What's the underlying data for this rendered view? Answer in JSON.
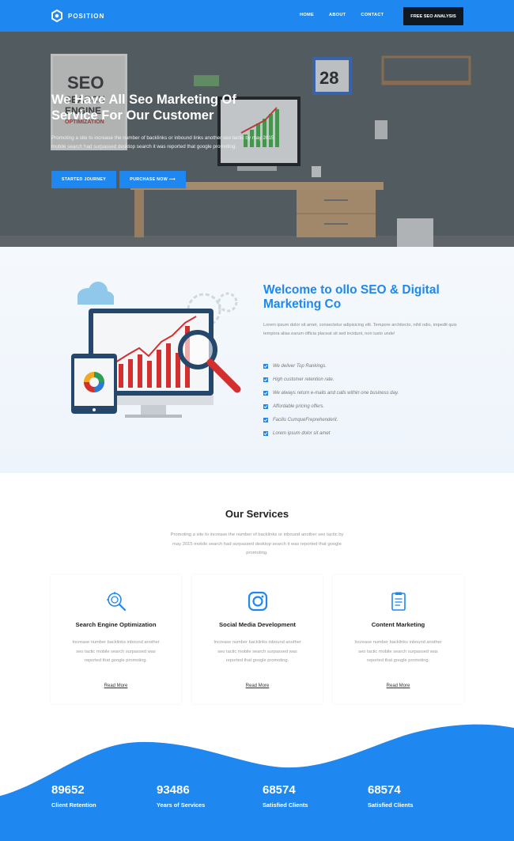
{
  "nav": {
    "brand": "POSITION",
    "links": [
      "HOME",
      "ABOUT",
      "CONTACT"
    ],
    "cta": "FREE SEO ANALYSIS"
  },
  "hero": {
    "title": "We Have All Seo Marketing Of Service For Our Customer",
    "text": "Promoting a site to increase the number of backlinks or inbound links another seo tactic by may 2015 mobile search had surpassed desktop search it was reported that google promoting.",
    "btn_start": "STARTED JOURNEY",
    "btn_buy": "PURCHASE NOW ⟶",
    "calendar_number": "28",
    "poster_text": "SEO",
    "poster_sub": "SEARCH",
    "poster_sub2": "ENGINE",
    "poster_sub3": "OPTIMIZATION"
  },
  "welcome": {
    "title": "Welcome to ollo SEO & Digital Marketing Co",
    "text": "Lorem ipsum dolor sit amet, consectetur adipisicing elit. Tempore architecto, nihil odio, impedit quis tempora alias earum officia placeat sit sed incidunt, non iusto unde!",
    "items": [
      "We deliver Top Rankings.",
      "High customer retention rate.",
      "We always return e-mails and calls within one business day.",
      "Affordable pricing offers.",
      "Facilis CumqueFreprehenderit.",
      "Lorem ipsum dolor sit amet"
    ]
  },
  "services": {
    "title": "Our Services",
    "text": "Promoting a site to increase the number of backlinks or inbound another seo tactic by may 2015 mobile search had surpassed desktop search it was reported that google promoting.",
    "cards": [
      {
        "title": "Search Engine Optimization",
        "text": "Increase number backlinks inbound another seo tactic mobile search surpassed was reported that google promoting.",
        "link": "Read More",
        "icon": "seo-search-icon"
      },
      {
        "title": "Social Media Development",
        "text": "Increase number backlinks inbound another seo tactic mobile search surpassed was reported that google promoting.",
        "link": "Read More",
        "icon": "instagram-icon"
      },
      {
        "title": "Content Marketing",
        "text": "Increase number backlinks inbound another seo tactic mobile search surpassed was reported that google promoting.",
        "link": "Read More",
        "icon": "document-icon"
      }
    ]
  },
  "stats": [
    {
      "num": "89652",
      "label": "Client Retention"
    },
    {
      "num": "93486",
      "label": "Years of Services"
    },
    {
      "num": "68574",
      "label": "Satisfied Clients"
    },
    {
      "num": "68574",
      "label": "Satisfied Clients"
    }
  ],
  "colors": {
    "accent": "#1e88f0",
    "dark": "#121820"
  }
}
